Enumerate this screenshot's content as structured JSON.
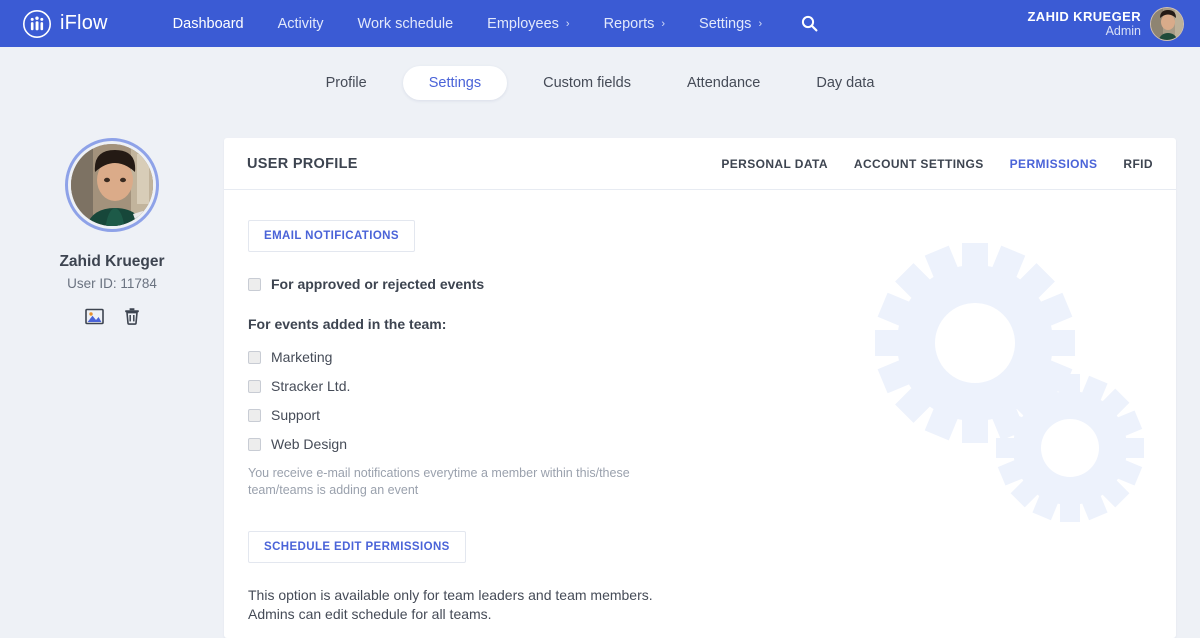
{
  "navbar": {
    "brand": {
      "logo_icon": "iflow-people-circle-icon",
      "text": "iFlow"
    },
    "links": [
      {
        "label": "Dashboard",
        "caret": "",
        "active": true
      },
      {
        "label": "Activity",
        "caret": "",
        "active": false
      },
      {
        "label": "Work schedule",
        "caret": "",
        "active": false
      },
      {
        "label": "Employees",
        "caret": "›",
        "active": false
      },
      {
        "label": "Reports",
        "caret": "›",
        "active": false
      },
      {
        "label": "Settings",
        "caret": "›",
        "active": false
      }
    ],
    "search_icon": "search-icon",
    "user": {
      "name": "ZAHID KRUEGER",
      "role": "Admin",
      "avatar": "user-avatar"
    }
  },
  "tabs": [
    {
      "label": "Profile",
      "active": false
    },
    {
      "label": "Settings",
      "active": true
    },
    {
      "label": "Custom fields",
      "active": false
    },
    {
      "label": "Attendance",
      "active": false
    },
    {
      "label": "Day data",
      "active": false
    }
  ],
  "left_panel": {
    "avatar": "profile-photo",
    "name": "Zahid Krueger",
    "user_id": "User ID: 11784",
    "actions": [
      {
        "icon": "image-upload-icon",
        "name": "change-photo-button"
      },
      {
        "icon": "trash-icon",
        "name": "delete-photo-button"
      }
    ]
  },
  "card": {
    "title": "USER PROFILE",
    "subnav": [
      {
        "label": "PERSONAL DATA",
        "active": false
      },
      {
        "label": "ACCOUNT SETTINGS",
        "active": false
      },
      {
        "label": "PERMISSIONS",
        "active": true
      },
      {
        "label": "RFID",
        "active": false
      }
    ],
    "email_notifications": {
      "section_label": "EMAIL NOTIFICATIONS",
      "approved_rejected": {
        "label": "For approved or rejected events",
        "checked": false
      },
      "team_events_title": "For events added in the team:",
      "teams": [
        {
          "label": "Marketing",
          "checked": false
        },
        {
          "label": "Stracker Ltd.",
          "checked": false
        },
        {
          "label": "Support",
          "checked": false
        },
        {
          "label": "Web Design",
          "checked": false
        }
      ],
      "hint": "You receive e-mail notifications everytime a member within this/these team/teams is adding an event"
    },
    "schedule_edit": {
      "section_label": "SCHEDULE EDIT PERMISSIONS",
      "line1": "This option is available only for team leaders and team members.",
      "line2": "Admins can edit schedule for all teams."
    }
  },
  "colors": {
    "navbar_blue": "#3b5bd4",
    "accent_blue": "#4a63d8",
    "page_bg": "#eef1f6",
    "card_bg": "#ffffff",
    "gear_watermark": "#eef3fc"
  }
}
